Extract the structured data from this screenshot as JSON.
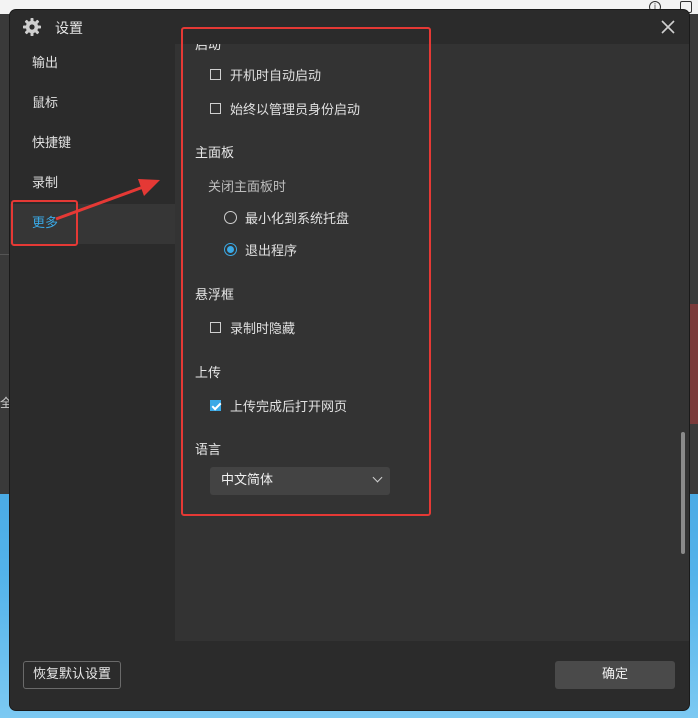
{
  "window": {
    "title": "设置"
  },
  "sidebar": {
    "items": [
      {
        "label": "输出",
        "active": false
      },
      {
        "label": "鼠标",
        "active": false
      },
      {
        "label": "快捷键",
        "active": false
      },
      {
        "label": "录制",
        "active": false
      },
      {
        "label": "更多",
        "active": true
      }
    ]
  },
  "content": {
    "startup": {
      "partial_title": "启动",
      "options": [
        {
          "label": "开机时自动启动",
          "checked": false
        },
        {
          "label": "始终以管理员身份启动",
          "checked": false
        }
      ]
    },
    "main_panel": {
      "title": "主面板",
      "subtitle": "关闭主面板时",
      "options": [
        {
          "label": "最小化到系统托盘",
          "selected": false
        },
        {
          "label": "退出程序",
          "selected": true
        }
      ]
    },
    "floating": {
      "title": "悬浮框",
      "options": [
        {
          "label": "录制时隐藏",
          "checked": false
        }
      ]
    },
    "upload": {
      "title": "上传",
      "options": [
        {
          "label": "上传完成后打开网页",
          "checked": true
        }
      ]
    },
    "language": {
      "title": "语言",
      "selected": "中文简体"
    }
  },
  "footer": {
    "reset_label": "恢复默认设置",
    "ok_label": "确定"
  },
  "background": {
    "partial_text": "全"
  },
  "colors": {
    "accent": "#3aa9e6",
    "annotation": "#e53935",
    "dialog_bg": "#2b2b2b",
    "content_bg": "#333333"
  }
}
